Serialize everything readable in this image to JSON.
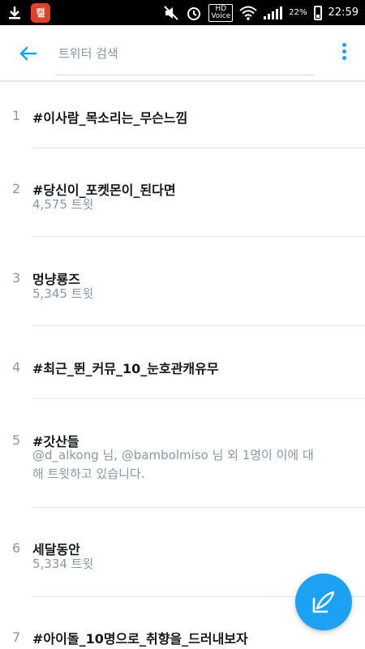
{
  "status_bar": {
    "app_badge": "캘",
    "hd_label": "HD",
    "voice_label": "Voice",
    "battery_percent": "22%",
    "time": "22:59"
  },
  "search": {
    "placeholder": "트위터 검색"
  },
  "trends": [
    {
      "rank": "1",
      "title": "#이사람_목소리는_무슨느낌",
      "sub": ""
    },
    {
      "rank": "2",
      "title": "#당신이_포켓몬이_된다면",
      "sub": "4,575 트윗"
    },
    {
      "rank": "3",
      "title": "멍냥룡즈",
      "sub": "5,345 트윗"
    },
    {
      "rank": "4",
      "title": "#최근_뛴_커뮤_10_눈호관캐유무",
      "sub": ""
    },
    {
      "rank": "5",
      "title": "#갓산들",
      "sub": "@d_alkong 님, @bambolmiso 님 외 1명이 이에 대해 트윗하고 있습니다."
    },
    {
      "rank": "6",
      "title": "세달동안",
      "sub": "5,334 트윗"
    },
    {
      "rank": "7",
      "title": "#아이돌_10명으로_취향을_드러내보자",
      "sub": ""
    }
  ],
  "colors": {
    "accent": "#1da1f2",
    "status_bar": "#000000"
  },
  "icons": {
    "download": "download-icon",
    "mute": "mute-icon",
    "alarm": "alarm-icon",
    "wifi": "wifi-icon",
    "signal": "signal-icon",
    "battery": "battery-icon",
    "back": "back-arrow-icon",
    "more": "more-vertical-icon",
    "compose": "compose-tweet-icon"
  }
}
